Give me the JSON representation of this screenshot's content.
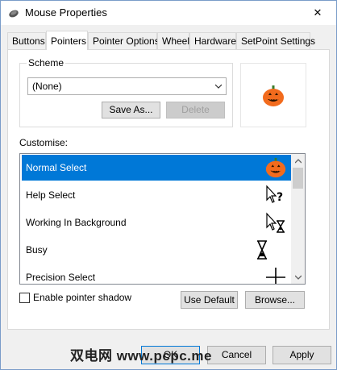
{
  "window": {
    "title": "Mouse Properties",
    "close_glyph": "✕"
  },
  "tabs": [
    {
      "label": "Buttons"
    },
    {
      "label": "Pointers"
    },
    {
      "label": "Pointer Options"
    },
    {
      "label": "Wheel"
    },
    {
      "label": "Hardware"
    },
    {
      "label": "SetPoint Settings"
    }
  ],
  "active_tab": "Pointers",
  "scheme": {
    "group_label": "Scheme",
    "selected": "(None)",
    "save_as_label": "Save As...",
    "delete_label": "Delete"
  },
  "customise": {
    "label": "Customise:",
    "items": [
      {
        "label": "Normal Select",
        "icon": "pumpkin-icon",
        "selected": true
      },
      {
        "label": "Help Select",
        "icon": "help-select-cursor-icon"
      },
      {
        "label": "Working In Background",
        "icon": "working-background-cursor-icon"
      },
      {
        "label": "Busy",
        "icon": "hourglass-icon"
      },
      {
        "label": "Precision Select",
        "icon": "crosshair-icon"
      }
    ]
  },
  "pointer_shadow": {
    "label": "Enable pointer shadow",
    "checked": false
  },
  "use_default_label": "Use Default",
  "browse_label": "Browse...",
  "footer": {
    "ok_label": "OK",
    "cancel_label": "Cancel",
    "apply_label": "Apply"
  },
  "watermark_text": "双电网 www.pcpc.me",
  "colors": {
    "selection": "#0078d7",
    "pumpkin": "#f26b1d"
  }
}
